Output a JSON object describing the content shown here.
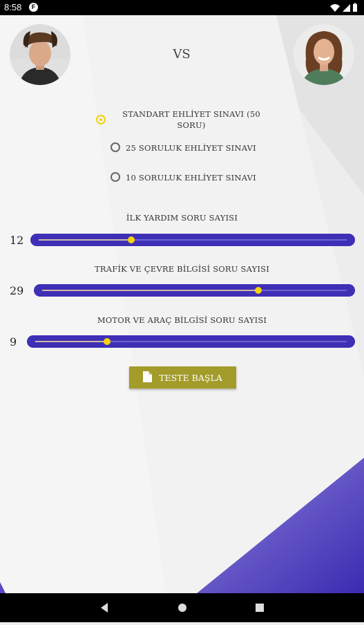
{
  "status_bar": {
    "time": "8:58",
    "notification_glyph": "F"
  },
  "header": {
    "vs_label": "VS"
  },
  "test_options": [
    {
      "label": "STANDART EHLİYET SINAVI (50 SORU)",
      "selected": true
    },
    {
      "label": "25 SORULUK EHLİYET SINAVI",
      "selected": false
    },
    {
      "label": "10 SORULUK EHLİYET SINAVI",
      "selected": false
    }
  ],
  "sliders": [
    {
      "label": "İLK YARDIM SORU SAYISI",
      "value": "12",
      "level": 0.3
    },
    {
      "label": "TRAFİK VE ÇEVRE BİLGİSİ SORU SAYISI",
      "value": "29",
      "level": 0.71
    },
    {
      "label": "MOTOR VE ARAÇ BİLGİSİ SORU SAYISI",
      "value": "9",
      "level": 0.23
    }
  ],
  "start_button": {
    "label": "TESTE BAŞLA",
    "icon": "document-icon"
  },
  "colors": {
    "slider_track": "#3e2fb6",
    "thumb": "#f5d20a",
    "button": "#a39b2a",
    "background_accent": "#5a48c4"
  }
}
